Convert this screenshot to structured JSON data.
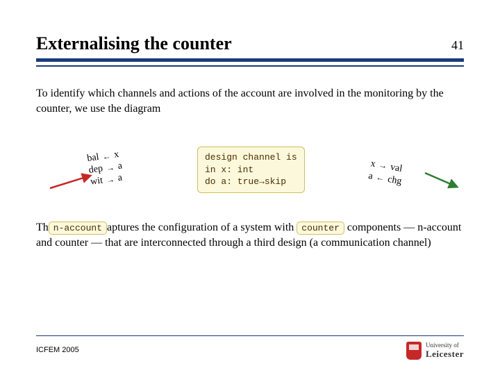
{
  "page_number": "41",
  "title": "Externalising the counter",
  "intro": "To identify which channels and actions of the account are involved in the monitoring by the counter, we use the diagram",
  "left": {
    "r1_a": "bal",
    "r1_arrow": "←",
    "r1_b": "x",
    "r2_a": "dep",
    "r2_arrow": "→",
    "r2_b": "a",
    "r3_a": "wit",
    "r3_arrow": "→",
    "r3_b": "a"
  },
  "center": {
    "l1": "design channel is",
    "l2": "in x: int",
    "l3": "do a: true→skip"
  },
  "right": {
    "r1_a": "x",
    "r1_arrow": "→",
    "r1_b": "val",
    "r2_a": "a",
    "r2_arrow": "←",
    "r2_b": "chg"
  },
  "para2_pre": "Th",
  "tag1": "n-account",
  "para2_mid1": "aptures the configuration of a system with ",
  "tag2": "counter",
  "para2_mid2": " components — n-account and counter — that are interconnected through a third design (a communication channel)",
  "footer": "ICFEM 2005",
  "uni_line1": "University of",
  "uni_line2": "Leicester"
}
